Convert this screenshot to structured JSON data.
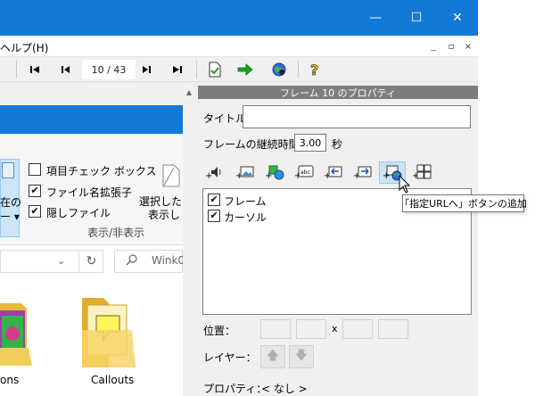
{
  "menu": {
    "help_label": "ヘルプ(H)"
  },
  "window_controls": {
    "minimize": "—",
    "maximize": "☐",
    "close": "✕"
  },
  "mdi_controls": {
    "minimize": "_",
    "restore": "▫",
    "close": "×"
  },
  "toolbar": {
    "page_indicator": "10 / 43"
  },
  "explorer": {
    "ribbon": {
      "checkboxes": [
        {
          "label": "項目チェック ボックス",
          "checked": false
        },
        {
          "label": "ファイル名拡張子",
          "checked": true
        },
        {
          "label": "隠しファイル",
          "checked": true
        }
      ],
      "partial_left_1": "在の",
      "partial_left_2": "ー ▾",
      "right_text_1": "選択した",
      "right_text_2": "表示し",
      "group_label": "表示/非表示"
    },
    "search_placeholder": "Wink0",
    "folders": [
      {
        "label": "ons"
      },
      {
        "label": "Callouts"
      }
    ]
  },
  "properties": {
    "header": "フレーム 10 のプロパティ",
    "title_label": "タイトル",
    "title_value": "",
    "duration_label": "フレームの継続時間",
    "duration_value": "3.00",
    "duration_unit": "秒",
    "list_items": [
      {
        "label": "フレーム",
        "checked": true
      },
      {
        "label": "カーソル",
        "checked": true
      }
    ],
    "position_label": "位置：",
    "position_separator": "x",
    "layer_label": "レイヤー：",
    "property_label": "プロパティ：",
    "property_value": "< なし >"
  },
  "tooltip": {
    "text": "「指定URLへ」ボタンの追加"
  },
  "colors": {
    "titlebar": "#1279d7",
    "panel_header": "#7d7d7d",
    "selection": "#cce4f7",
    "folder_yellow": "#f6d365",
    "green_arrow": "#1aa31a"
  }
}
